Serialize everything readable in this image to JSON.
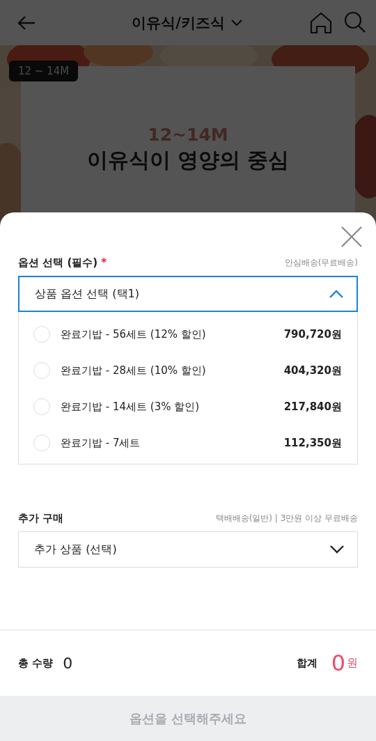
{
  "header": {
    "title": "이유식/키즈식"
  },
  "banner": {
    "tag": "12 ~ 14M",
    "card_subtitle": "12~14M",
    "card_title": "이유식이 영양의 중심"
  },
  "sheet": {
    "required_section": {
      "label": "옵션 선택 (필수)",
      "required_mark": "*",
      "shipping": "안심배송(무료배송)",
      "select": {
        "value": "상품 옵션 선택 (택1)",
        "expanded": true
      },
      "options": [
        {
          "name": "완료기밥 - 56세트 (12% 할인)",
          "price": "790,720원",
          "selected": false
        },
        {
          "name": "완료기밥 - 28세트 (10% 할인)",
          "price": "404,320원",
          "selected": false
        },
        {
          "name": "완료기밥 - 14세트 (3% 할인)",
          "price": "217,840원",
          "selected": false
        },
        {
          "name": "완료기밥 - 7세트",
          "price": "112,350원",
          "selected": false
        }
      ]
    },
    "extra_section": {
      "label": "추가 구매",
      "shipping": "택배배송(일반) | 3만원 이상 무료배송",
      "select": {
        "value": "추가 상품 (선택)",
        "expanded": false
      }
    },
    "summary": {
      "quantity_label": "총 수량",
      "quantity": "0",
      "total_label": "합계",
      "total": "0",
      "currency": "원"
    },
    "submit_button": {
      "label": "옵션을 선택해주세요",
      "disabled": true
    }
  }
}
